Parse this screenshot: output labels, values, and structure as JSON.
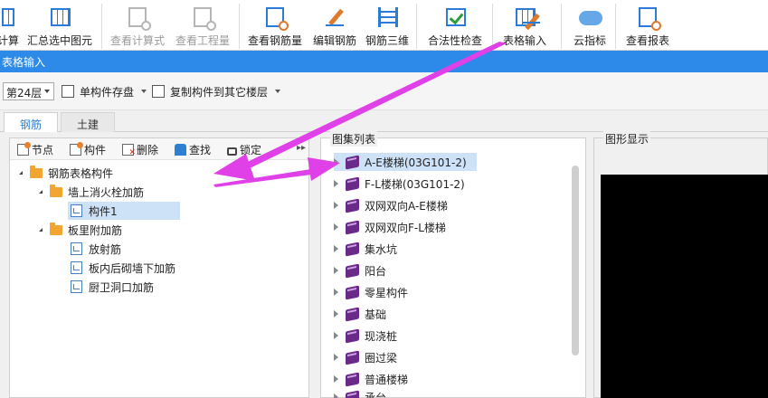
{
  "ribbon": {
    "buttons": [
      {
        "label": "计算",
        "icon": "calc-icon",
        "disabled": false
      },
      {
        "label": "汇总选中图元",
        "icon": "summary-icon",
        "disabled": false
      },
      {
        "label": "查看计算式",
        "icon": "view-formula-icon",
        "disabled": true
      },
      {
        "label": "查看工程量",
        "icon": "view-quantity-icon",
        "disabled": true
      },
      {
        "label": "查看钢筋量",
        "icon": "view-rebar-icon",
        "disabled": false
      },
      {
        "label": "编辑钢筋",
        "icon": "edit-rebar-icon",
        "disabled": false
      },
      {
        "label": "钢筋三维",
        "icon": "rebar-3d-icon",
        "disabled": false
      },
      {
        "label": "合法性检查",
        "icon": "validity-check-icon",
        "disabled": false
      },
      {
        "label": "表格输入",
        "icon": "table-input-icon",
        "disabled": false
      },
      {
        "label": "云指标",
        "icon": "cloud-index-icon",
        "disabled": false
      },
      {
        "label": "查看报表",
        "icon": "view-report-icon",
        "disabled": false
      }
    ]
  },
  "window": {
    "title": "表格输入"
  },
  "toolbar": {
    "floor_value": "第24层",
    "save_single_label": "单构件存盘",
    "copy_label": "复制构件到其它楼层"
  },
  "tabs": [
    {
      "label": "钢筋",
      "active": true
    },
    {
      "label": "土建",
      "active": false
    }
  ],
  "left_toolbar": {
    "node_label": "节点",
    "component_label": "构件",
    "delete_label": "删除",
    "find_label": "查找",
    "lock_label": "锁定"
  },
  "tree": [
    {
      "label": "钢筋表格构件",
      "type": "folder",
      "level": 0,
      "expanded": true,
      "selected": false
    },
    {
      "label": "墙上消火栓加筋",
      "type": "folder",
      "level": 1,
      "expanded": true,
      "selected": false
    },
    {
      "label": "构件1",
      "type": "leaf",
      "level": 2,
      "selected": true
    },
    {
      "label": "板里附加筋",
      "type": "folder",
      "level": 1,
      "expanded": true,
      "selected": false
    },
    {
      "label": "放射筋",
      "type": "leaf",
      "level": 2,
      "selected": false
    },
    {
      "label": "板内后砌墙下加筋",
      "type": "leaf",
      "level": 2,
      "selected": false
    },
    {
      "label": "厨卫洞口加筋",
      "type": "leaf",
      "level": 2,
      "selected": false
    }
  ],
  "atlas": {
    "title": "图集列表",
    "items": [
      {
        "label": "A-E楼梯(03G101-2)",
        "selected": true
      },
      {
        "label": "F-L楼梯(03G101-2)",
        "selected": false
      },
      {
        "label": "双网双向A-E楼梯",
        "selected": false
      },
      {
        "label": "双网双向F-L楼梯",
        "selected": false
      },
      {
        "label": "集水坑",
        "selected": false
      },
      {
        "label": "阳台",
        "selected": false
      },
      {
        "label": "零星构件",
        "selected": false
      },
      {
        "label": "基础",
        "selected": false
      },
      {
        "label": "现浇桩",
        "selected": false
      },
      {
        "label": "圈过梁",
        "selected": false
      },
      {
        "label": "普通楼梯",
        "selected": false
      },
      {
        "label": "承台",
        "selected": false
      }
    ]
  },
  "preview": {
    "title": "图形显示"
  },
  "colors": {
    "accent": "#2d8ae8",
    "annotation_arrow": "#e040e8",
    "selection": "#cde1f7"
  }
}
